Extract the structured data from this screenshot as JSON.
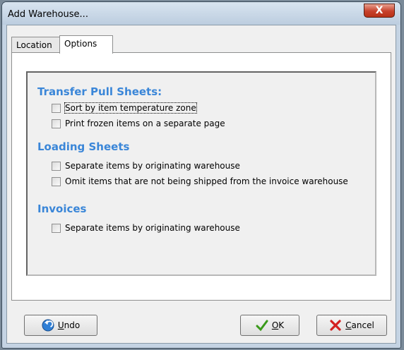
{
  "window": {
    "title": "Add Warehouse...",
    "close_glyph": "X"
  },
  "tabs": [
    {
      "label": "Location",
      "active": false
    },
    {
      "label": "Options",
      "active": true
    }
  ],
  "sections": [
    {
      "heading": "Transfer Pull Sheets:",
      "options": [
        {
          "label": "Sort by item temperature zone",
          "checked": false,
          "focused": true
        },
        {
          "label": "Print frozen items on a separate page",
          "checked": false
        }
      ]
    },
    {
      "heading": "Loading Sheets",
      "options": [
        {
          "label": "Separate items by originating warehouse",
          "checked": false
        },
        {
          "label": "Omit items that are not being shipped from the invoice warehouse",
          "checked": false
        }
      ]
    },
    {
      "heading": "Invoices",
      "options": [
        {
          "label": "Separate items by originating warehouse",
          "checked": false
        }
      ]
    }
  ],
  "buttons": {
    "undo": {
      "mnemonic": "U",
      "rest": "ndo",
      "icon": "undo-arrow-icon"
    },
    "ok": {
      "mnemonic": "O",
      "rest": "K",
      "icon": "checkmark-icon"
    },
    "cancel": {
      "mnemonic": "C",
      "rest": "ancel",
      "icon": "red-x-icon"
    }
  },
  "colors": {
    "heading": "#3a86d8",
    "close_button": "#c7412b"
  }
}
